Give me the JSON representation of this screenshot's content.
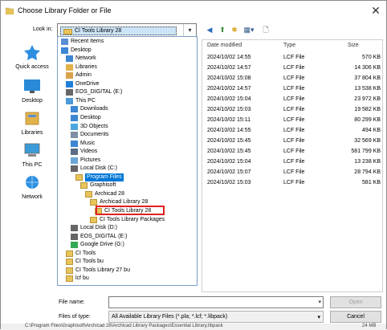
{
  "window": {
    "title": "Choose Library Folder or File",
    "close_glyph": "✕"
  },
  "lookin": {
    "label": "Look in:",
    "value": "CI Tools Library 28",
    "arrow": "▾"
  },
  "toolbar": {
    "back_glyph": "◀",
    "up_glyph": "⬆",
    "newfolder_glyph": "✱",
    "views_glyph": "▦▾",
    "props_glyph": "🗋"
  },
  "places": [
    {
      "label": "Quick access",
      "icon": "star-icon"
    },
    {
      "label": "Desktop",
      "icon": "desktop-icon"
    },
    {
      "label": "Libraries",
      "icon": "libraries-icon"
    },
    {
      "label": "This PC",
      "icon": "pc-icon"
    },
    {
      "label": "Network",
      "icon": "network-icon"
    }
  ],
  "columns": {
    "date": "Date modified",
    "type": "Type",
    "size": "Size"
  },
  "files": [
    {
      "date": "2024/10/02 14:55",
      "type": "LCF File",
      "size": "570 KB"
    },
    {
      "date": "2024/10/02 14:57",
      "type": "LCF File",
      "size": "14 306 KB"
    },
    {
      "date": "2024/10/02 15:08",
      "type": "LCF File",
      "size": "37 804 KB"
    },
    {
      "date": "2024/10/02 14:57",
      "type": "LCF File",
      "size": "13 538 KB"
    },
    {
      "date": "2024/10/02 15:04",
      "type": "LCF File",
      "size": "23 972 KB"
    },
    {
      "date": "2024/10/02 15:03",
      "type": "LCF File",
      "size": "19 582 KB"
    },
    {
      "date": "2024/10/02 15:11",
      "type": "LCF File",
      "size": "80 299 KB"
    },
    {
      "date": "2024/10/02 14:55",
      "type": "LCF File",
      "size": "494 KB"
    },
    {
      "date": "2024/10/02 15:45",
      "type": "LCF File",
      "size": "32 569 KB"
    },
    {
      "date": "2024/10/02 15:45",
      "type": "LCF File",
      "size": "581 799 KB"
    },
    {
      "date": "2024/10/02 15:04",
      "type": "LCF File",
      "size": "13 238 KB"
    },
    {
      "date": "2024/10/02 15:07",
      "type": "LCF File",
      "size": "28 794 KB"
    },
    {
      "date": "2024/10/02 15:03",
      "type": "LCF File",
      "size": "581 KB"
    }
  ],
  "dropdown": [
    {
      "label": "Recent Items",
      "indent": 0,
      "icon": "recent-icon",
      "color": "#5b8fd6"
    },
    {
      "label": "Desktop",
      "indent": 0,
      "icon": "desktop-icon",
      "color": "#3c86d3"
    },
    {
      "label": "Network",
      "indent": 1,
      "icon": "network-icon",
      "color": "#3c86d3"
    },
    {
      "label": "Libraries",
      "indent": 1,
      "icon": "libraries-icon",
      "color": "#e2b24a"
    },
    {
      "label": "Admin",
      "indent": 1,
      "icon": "user-icon",
      "color": "#d9a24b"
    },
    {
      "label": "OneDrive",
      "indent": 1,
      "icon": "cloud-icon",
      "color": "#1f7fd8"
    },
    {
      "label": "EOS_DIGITAL (E:)",
      "indent": 1,
      "icon": "drive-icon",
      "color": "#666666"
    },
    {
      "label": "This PC",
      "indent": 1,
      "icon": "pc-icon",
      "color": "#4c9ad8"
    },
    {
      "label": "Downloads",
      "indent": 2,
      "icon": "download-icon",
      "color": "#3c86d3"
    },
    {
      "label": "Desktop",
      "indent": 2,
      "icon": "desktop-icon",
      "color": "#3c86d3"
    },
    {
      "label": "3D Objects",
      "indent": 2,
      "icon": "cube-icon",
      "color": "#4aa6e0"
    },
    {
      "label": "Documents",
      "indent": 2,
      "icon": "document-icon",
      "color": "#7d8ea6"
    },
    {
      "label": "Music",
      "indent": 2,
      "icon": "music-icon",
      "color": "#3c86d3"
    },
    {
      "label": "Videos",
      "indent": 2,
      "icon": "video-icon",
      "color": "#5a6c86"
    },
    {
      "label": "Pictures",
      "indent": 2,
      "icon": "picture-icon",
      "color": "#6aa6d6"
    },
    {
      "label": "Local Disk (C:)",
      "indent": 2,
      "icon": "drive-icon",
      "color": "#666666"
    },
    {
      "label": "Program Files",
      "indent": 3,
      "icon": "folder-icon",
      "color": "#e8c45a",
      "selected": true
    },
    {
      "label": "Graphisoft",
      "indent": 4,
      "icon": "folder-icon",
      "color": "#e8c45a"
    },
    {
      "label": "Archicad 28",
      "indent": 5,
      "icon": "folder-icon",
      "color": "#e8c45a"
    },
    {
      "label": "Archicad Library 28",
      "indent": 6,
      "icon": "folder-icon",
      "color": "#e8c45a"
    },
    {
      "label": "CI Tools Library 28",
      "indent": 7,
      "icon": "folder-open-icon",
      "color": "#e8c45a"
    },
    {
      "label": "CI Tools Library Packages",
      "indent": 6,
      "icon": "folder-icon",
      "color": "#e8c45a"
    },
    {
      "label": "Local Disk (D:)",
      "indent": 2,
      "icon": "drive-icon",
      "color": "#666666"
    },
    {
      "label": "EOS_DIGITAL (E:)",
      "indent": 2,
      "icon": "drive-icon",
      "color": "#666666"
    },
    {
      "label": "Google Drive (G:)",
      "indent": 2,
      "icon": "gdrive-icon",
      "color": "#34a853"
    },
    {
      "label": "CI Tools",
      "indent": 1,
      "icon": "folder-icon",
      "color": "#e8c45a"
    },
    {
      "label": "CI Tools bu",
      "indent": 1,
      "icon": "folder-icon",
      "color": "#e8c45a"
    },
    {
      "label": "CI Tools Library 27 bu",
      "indent": 1,
      "icon": "folder-icon",
      "color": "#e8c45a"
    },
    {
      "label": "lcf bu",
      "indent": 1,
      "icon": "folder-icon",
      "color": "#e8c45a"
    }
  ],
  "filename": {
    "label": "File name:",
    "value": "",
    "arrow": "▾"
  },
  "filetype": {
    "label": "Files of type:",
    "value": "All Available Library Files (*.pla; *.lcf; *.libpack)",
    "arrow": "▾"
  },
  "buttons": {
    "open": "Open",
    "cancel": "Cancel"
  },
  "status": {
    "path": "C:\\Program Files\\Graphisoft\\Archicad 28\\Archicad Library Packages\\Essential Library.libpack",
    "size": "24 MB"
  }
}
